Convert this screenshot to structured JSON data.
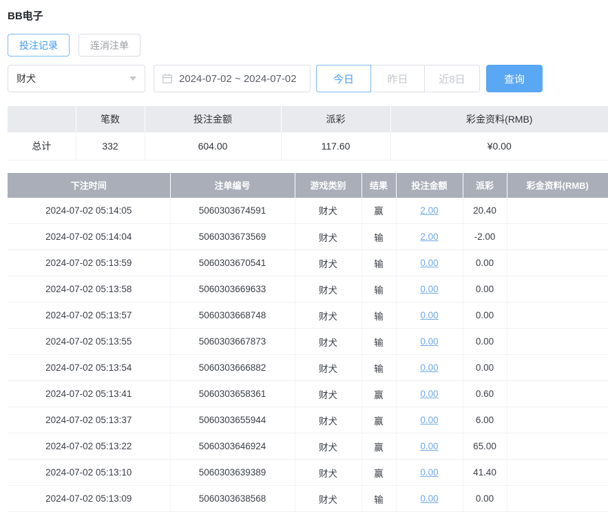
{
  "page": {
    "title": "BB电子"
  },
  "tabs": [
    {
      "label": "投注记录",
      "active": true
    },
    {
      "label": "连消注单",
      "active": false
    }
  ],
  "filters": {
    "game_select_value": "财犬",
    "date_range": "2024-07-02 ~ 2024-07-02",
    "quick_buttons": [
      {
        "label": "今日",
        "active": true
      },
      {
        "label": "昨日",
        "active": false
      },
      {
        "label": "近8日",
        "active": false
      }
    ],
    "search_label": "查询"
  },
  "colors": {
    "accent_blue": "#4b9ef2",
    "button_fill_blue": "#5aa7f3",
    "link_blue": "#6da8e8",
    "negative_red": "#f04848",
    "table_header_grey": "#a9aeb8",
    "summary_header_grey": "#e9eaee"
  },
  "summary": {
    "headers": [
      "",
      "笔数",
      "投注金额",
      "派彩",
      "彩金资料(RMB)"
    ],
    "row_label": "总计",
    "count": "332",
    "bet_amount": "604.00",
    "payout": "117.60",
    "bonus": "¥0.00"
  },
  "table": {
    "headers": [
      "下注时间",
      "注单编号",
      "游戏类别",
      "结果",
      "投注金额",
      "派彩",
      "彩金资料(RMB)"
    ],
    "rows": [
      {
        "time": "2024-07-02 05:14:05",
        "order": "5060303674591",
        "game": "财犬",
        "result": "赢",
        "bet": "2.00",
        "payout": "20.40",
        "bonus": ""
      },
      {
        "time": "2024-07-02 05:14:04",
        "order": "5060303673569",
        "game": "财犬",
        "result": "输",
        "bet": "2.00",
        "payout": "-2.00",
        "bonus": ""
      },
      {
        "time": "2024-07-02 05:13:59",
        "order": "5060303670541",
        "game": "财犬",
        "result": "输",
        "bet": "0.00",
        "payout": "0.00",
        "bonus": ""
      },
      {
        "time": "2024-07-02 05:13:58",
        "order": "5060303669633",
        "game": "财犬",
        "result": "输",
        "bet": "0.00",
        "payout": "0.00",
        "bonus": ""
      },
      {
        "time": "2024-07-02 05:13:57",
        "order": "5060303668748",
        "game": "财犬",
        "result": "输",
        "bet": "0.00",
        "payout": "0.00",
        "bonus": ""
      },
      {
        "time": "2024-07-02 05:13:55",
        "order": "5060303667873",
        "game": "财犬",
        "result": "输",
        "bet": "0.00",
        "payout": "0.00",
        "bonus": ""
      },
      {
        "time": "2024-07-02 05:13:54",
        "order": "5060303666882",
        "game": "财犬",
        "result": "输",
        "bet": "0.00",
        "payout": "0.00",
        "bonus": ""
      },
      {
        "time": "2024-07-02 05:13:41",
        "order": "5060303658361",
        "game": "财犬",
        "result": "赢",
        "bet": "0.00",
        "payout": "0.60",
        "bonus": ""
      },
      {
        "time": "2024-07-02 05:13:37",
        "order": "5060303655944",
        "game": "财犬",
        "result": "赢",
        "bet": "0.00",
        "payout": "6.00",
        "bonus": ""
      },
      {
        "time": "2024-07-02 05:13:22",
        "order": "5060303646924",
        "game": "财犬",
        "result": "赢",
        "bet": "0.00",
        "payout": "65.00",
        "bonus": ""
      },
      {
        "time": "2024-07-02 05:13:10",
        "order": "5060303639389",
        "game": "财犬",
        "result": "赢",
        "bet": "0.00",
        "payout": "41.40",
        "bonus": ""
      },
      {
        "time": "2024-07-02 05:13:09",
        "order": "5060303638568",
        "game": "财犬",
        "result": "输",
        "bet": "0.00",
        "payout": "0.00",
        "bonus": ""
      }
    ]
  }
}
